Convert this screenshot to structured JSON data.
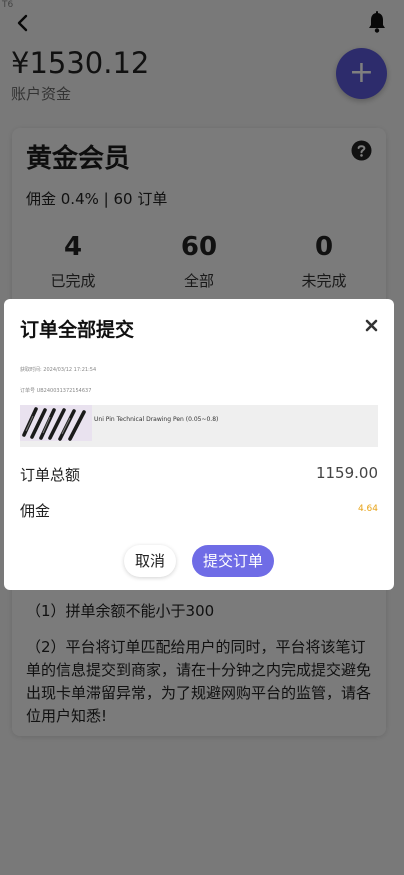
{
  "corner_tag": "T6",
  "header": {
    "balance": "¥1530.12",
    "balance_label": "账户资金",
    "fab_label": "+"
  },
  "membership": {
    "title": "黄金会员",
    "subtitle": "佣金 0.4% | 60 订单",
    "stats": [
      {
        "value": "4",
        "label": "已完成"
      },
      {
        "value": "60",
        "label": "全部"
      },
      {
        "value": "0",
        "label": "未完成"
      }
    ]
  },
  "notes": [
    "（1）拼单余额不能小于300",
    "（2）平台将订单匹配给用户的同时，平台将该笔订单的信息提交到商家，请在十分钟之内完成提交避免出现卡单滞留异常，为了规避网购平台的监管，请各位用户知悉!"
  ],
  "modal": {
    "title": "订单全部提交",
    "time_line": "获取时间:    2024/03/12 17:21:54",
    "order_no_line": "订单号 UB240031372154637",
    "product_name": "Uni Pin Technical Drawing Pen (0.05~0.8)",
    "total_label": "订单总额",
    "total_value": "1159.00",
    "commission_label": "佣金",
    "commission_value": "4.64",
    "cancel_label": "取消",
    "submit_label": "提交订单"
  },
  "colors": {
    "accent": "#6f6ce6",
    "fab": "#5a58d8",
    "commission": "#e8a317",
    "overlay": "rgba(0,0,0,0.5)"
  }
}
